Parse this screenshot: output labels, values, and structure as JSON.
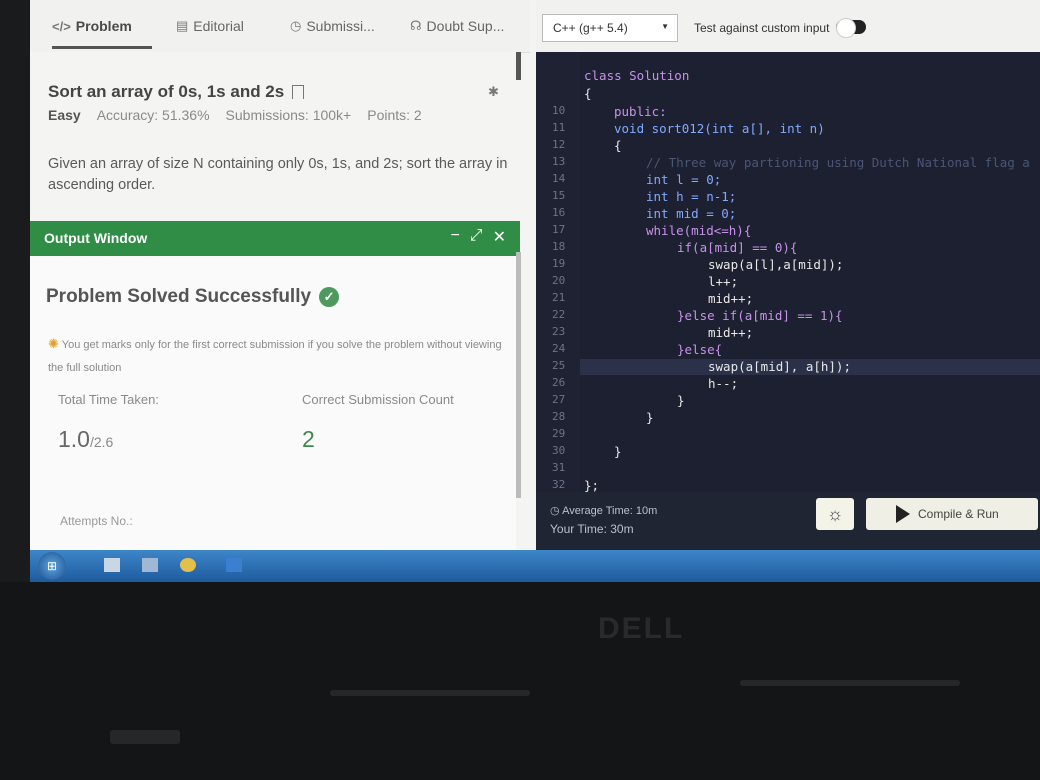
{
  "tabs": [
    {
      "label": "Problem",
      "icon": "code-icon"
    },
    {
      "label": "Editorial",
      "icon": "document-icon"
    },
    {
      "label": "Submissi...",
      "icon": "clock-icon"
    },
    {
      "label": "Doubt Sup...",
      "icon": "headset-icon"
    }
  ],
  "problem": {
    "title": "Sort an array of 0s, 1s and 2s",
    "difficulty": "Easy",
    "accuracy": "Accuracy: 51.36%",
    "submissions": "Submissions: 100k+",
    "points": "Points: 2",
    "description": "Given an array of size N containing only 0s, 1s, and 2s; sort the array in ascending order."
  },
  "output_window": {
    "title": "Output Window",
    "status": "Problem Solved Successfully",
    "note": "You get marks only for the first correct submission if you solve the problem without viewing the full solution",
    "total_time_label": "Total Time Taken:",
    "total_time_value": "1.0",
    "total_time_max": "/2.6",
    "correct_count_label": "Correct Submission Count",
    "correct_count_value": "2",
    "attempts_label": "Attempts No.:"
  },
  "editor": {
    "language": "C++ (g++ 5.4)",
    "custom_input_label": "Test against custom input",
    "custom_input_on": true,
    "average_time": "Average Time: 10m",
    "your_time": "Your Time: 30m",
    "run_label": "Compile & Run",
    "line_numbers": [
      "10",
      "11",
      "12",
      "13",
      "14",
      "15",
      "16",
      "17",
      "18",
      "19",
      "20",
      "21",
      "22",
      "23",
      "24",
      "25",
      "26",
      "27",
      "28",
      "29",
      "30",
      "31",
      "32"
    ],
    "code_lines": [
      "class Solution",
      "{",
      "public:",
      "void sort012(int a[], int n)",
      "{",
      "// Three way partioning using Dutch National flag a",
      "int l = 0;",
      "int h = n-1;",
      "int mid = 0;",
      "while(mid<=h){",
      "if(a[mid] == 0){",
      "swap(a[l],a[mid]);",
      "l++;",
      "mid++;",
      "}else if(a[mid] == 1){",
      "mid++;",
      "}else{",
      "swap(a[mid], a[h]);",
      "h--;",
      "}",
      "}",
      "}",
      "};"
    ]
  },
  "colors": {
    "output_bar": "#2f8d46",
    "success_check": "#4c9a5d",
    "editor_bg": "#1d2030"
  },
  "laptop_brand": "DELL"
}
